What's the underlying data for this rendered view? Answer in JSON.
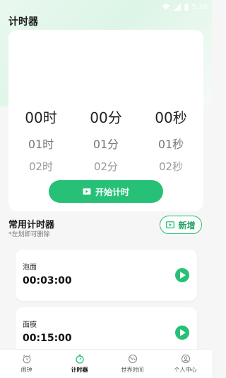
{
  "status_bar": {
    "time": "5:28"
  },
  "header": {
    "title": "计时器"
  },
  "picker": {
    "selected": [
      "00时",
      "00分",
      "00秒"
    ],
    "next": [
      "01时",
      "01分",
      "01秒"
    ],
    "next2": [
      "02时",
      "02分",
      "02秒"
    ],
    "start_label": "开始计时"
  },
  "common": {
    "title": "常用计时器",
    "hint": "*左划即可删除",
    "add_label": "新增",
    "timers": [
      {
        "name": "泡面",
        "time": "00:03:00"
      },
      {
        "name": "面膜",
        "time": "00:15:00"
      }
    ]
  },
  "tabbar": {
    "items": [
      {
        "label": "闹钟",
        "icon": "alarm-icon",
        "active": false
      },
      {
        "label": "计时器",
        "icon": "stopwatch-icon",
        "active": true
      },
      {
        "label": "世界时间",
        "icon": "globe-icon",
        "active": false
      },
      {
        "label": "个人中心",
        "icon": "profile-icon",
        "active": false
      }
    ]
  },
  "colors": {
    "accent": "#27c077"
  }
}
